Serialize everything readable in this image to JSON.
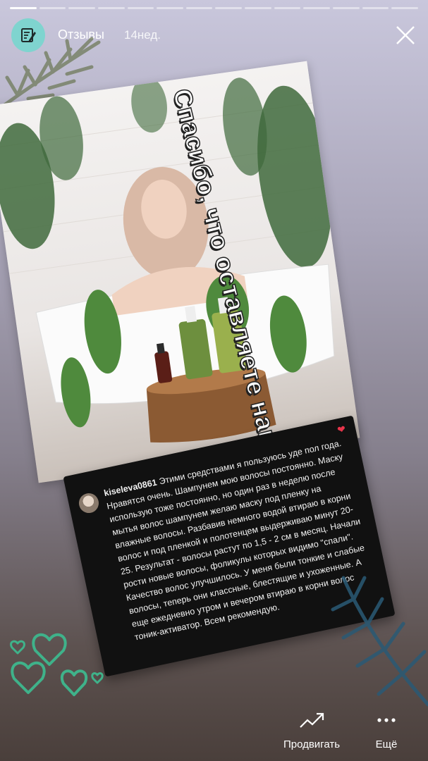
{
  "progress": {
    "total": 14,
    "current": 1
  },
  "header": {
    "author": "Отзывы",
    "time": "14нед.",
    "avatar_icon": "note-edit-icon",
    "close_icon": "close-icon"
  },
  "caption": "Спасибо, что оставляете нам отзывы!",
  "review": {
    "username": "kiseleva0861",
    "text": "Этими средствами я пользуюсь уде пол года. Нравятся очень. Шампунем мою волосы постоянно. Маску использую тоже постоянно, но один раз в неделю после мытья волос шампунем желаю маску под пленку на влажные волосы. Разбавив немного водой втираю в корни волос и под пленкой и полотенцем выдерживаю минут 20-25. Результат - волосы растут по 1,5 - 2 см в месяц. Начали рости новые волосы, фоликулы которых видимо \"спали\". Качество волос улучшилось. У меня были тонкие и слабые волосы, теперь они классные, блестящие и ухоженные. А еще ежедневно утром и вечером втираю в корни волос тоник-активатор. Всем рекомендую.",
    "heart_icon": "heart-icon"
  },
  "actions": {
    "promote_label": "Продвигать",
    "more_label": "Ещё"
  },
  "colors": {
    "accent_teal": "#7fd4cf",
    "heart_red": "#e8354b",
    "leaf_green": "#3fb28a"
  }
}
